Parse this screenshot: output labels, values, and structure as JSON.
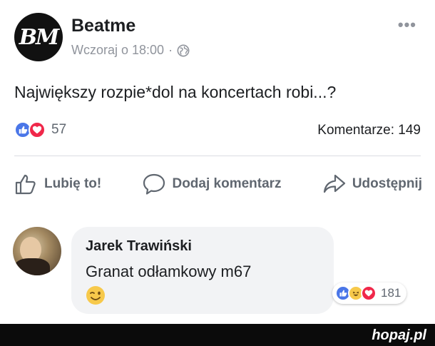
{
  "post": {
    "page_name": "Beatme",
    "logo_text": "BM",
    "timestamp": "Wczoraj o 18:00",
    "separator": "·",
    "text": "Największy rozpie*dol na koncertach robi...?",
    "reactions_count": "57",
    "comments_label": "Komentarze: 149"
  },
  "actions": {
    "like": "Lubię to!",
    "comment": "Dodaj komentarz",
    "share": "Udostępnij"
  },
  "comment": {
    "author": "Jarek Trawiński",
    "text": "Granat odłamkowy m67",
    "reactions_count": "181"
  },
  "watermark": "hopaj.pl",
  "colors": {
    "like": "#4a76e8",
    "love": "#f0284a",
    "haha": "#f7c94b",
    "text_secondary": "#606770",
    "bubble": "#f2f3f5"
  },
  "icons": [
    "more-icon",
    "globe-icon",
    "like-icon",
    "love-icon",
    "haha-icon",
    "thumbs-up-icon",
    "comment-icon",
    "share-icon",
    "wink-emoji"
  ]
}
